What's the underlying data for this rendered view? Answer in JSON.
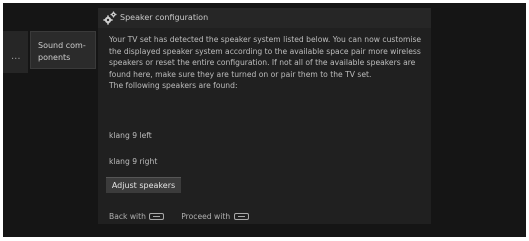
{
  "menu": {
    "left_marker": "...",
    "sound_components_label": "Sound com-\nponents"
  },
  "dialog": {
    "title": "Speaker configuration",
    "icon": "speaker-config-gear-icon",
    "body": "Your TV set has detected the speaker system listed below. You can now customise the displayed speaker system according to the available space pair more wireless speakers or reset the entire configuration. If not all of the available speakers are found here, make sure they are turned on or pair them to the TV set.",
    "found_label": "The following speakers are found:",
    "speakers": [
      "klang 9 left",
      "klang 9 right"
    ],
    "adjust_button": "Adjust speakers",
    "footer": {
      "back_label": "Back with",
      "proceed_label": "Proceed with",
      "key_icon": "remote-ok-key-icon"
    }
  },
  "colors": {
    "background": "#151515",
    "dialog": "#202020",
    "button": "#3b3b3b"
  }
}
